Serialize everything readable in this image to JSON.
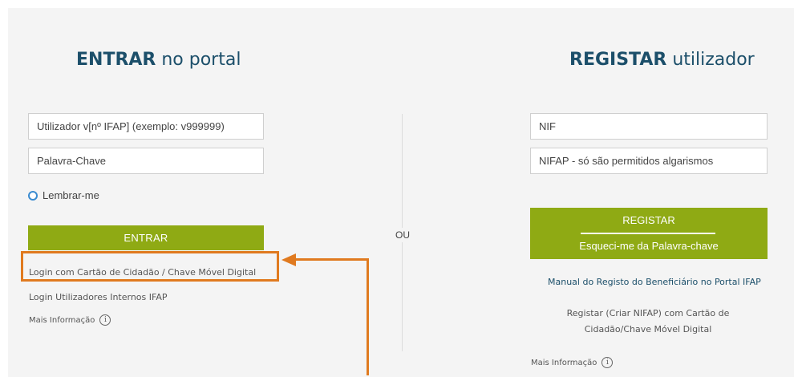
{
  "left": {
    "title_bold": "ENTRAR",
    "title_rest": " no portal",
    "username_placeholder": "Utilizador v[nº IFAP] (exemplo: v999999)",
    "password_placeholder": "Palavra-Chave",
    "remember_label": "Lembrar-me",
    "entrar_button": "ENTRAR",
    "cc_login_link": "Login com Cartão de Cidadão / Chave Móvel Digital",
    "internal_login_link": "Login Utilizadores Internos IFAP",
    "more_info": "Mais Informação",
    "info_icon_glyph": "i"
  },
  "divider_label": "OU",
  "right": {
    "title_bold": "REGISTAR",
    "title_rest": " utilizador",
    "nif_placeholder": "NIF",
    "nifap_placeholder": "NIFAP - só são permitidos algarismos",
    "registar_button": "REGISTAR",
    "forgot_password_button": "Esqueci-me da Palavra-chave",
    "manual_link": "Manual do Registo do Beneficiário no Portal IFAP",
    "create_nifap_link": "Registar (Criar NIFAP) com Cartão de Cidadão/Chave Móvel Digital",
    "more_info": "Mais Informação",
    "info_icon_glyph": "i"
  },
  "colors": {
    "accent_green": "#8faa14",
    "title_blue": "#1c4f6a",
    "annotation_orange": "#e07a1f"
  },
  "icons": [
    "radio-unchecked-icon",
    "info-icon",
    "annotation-arrow-icon"
  ]
}
